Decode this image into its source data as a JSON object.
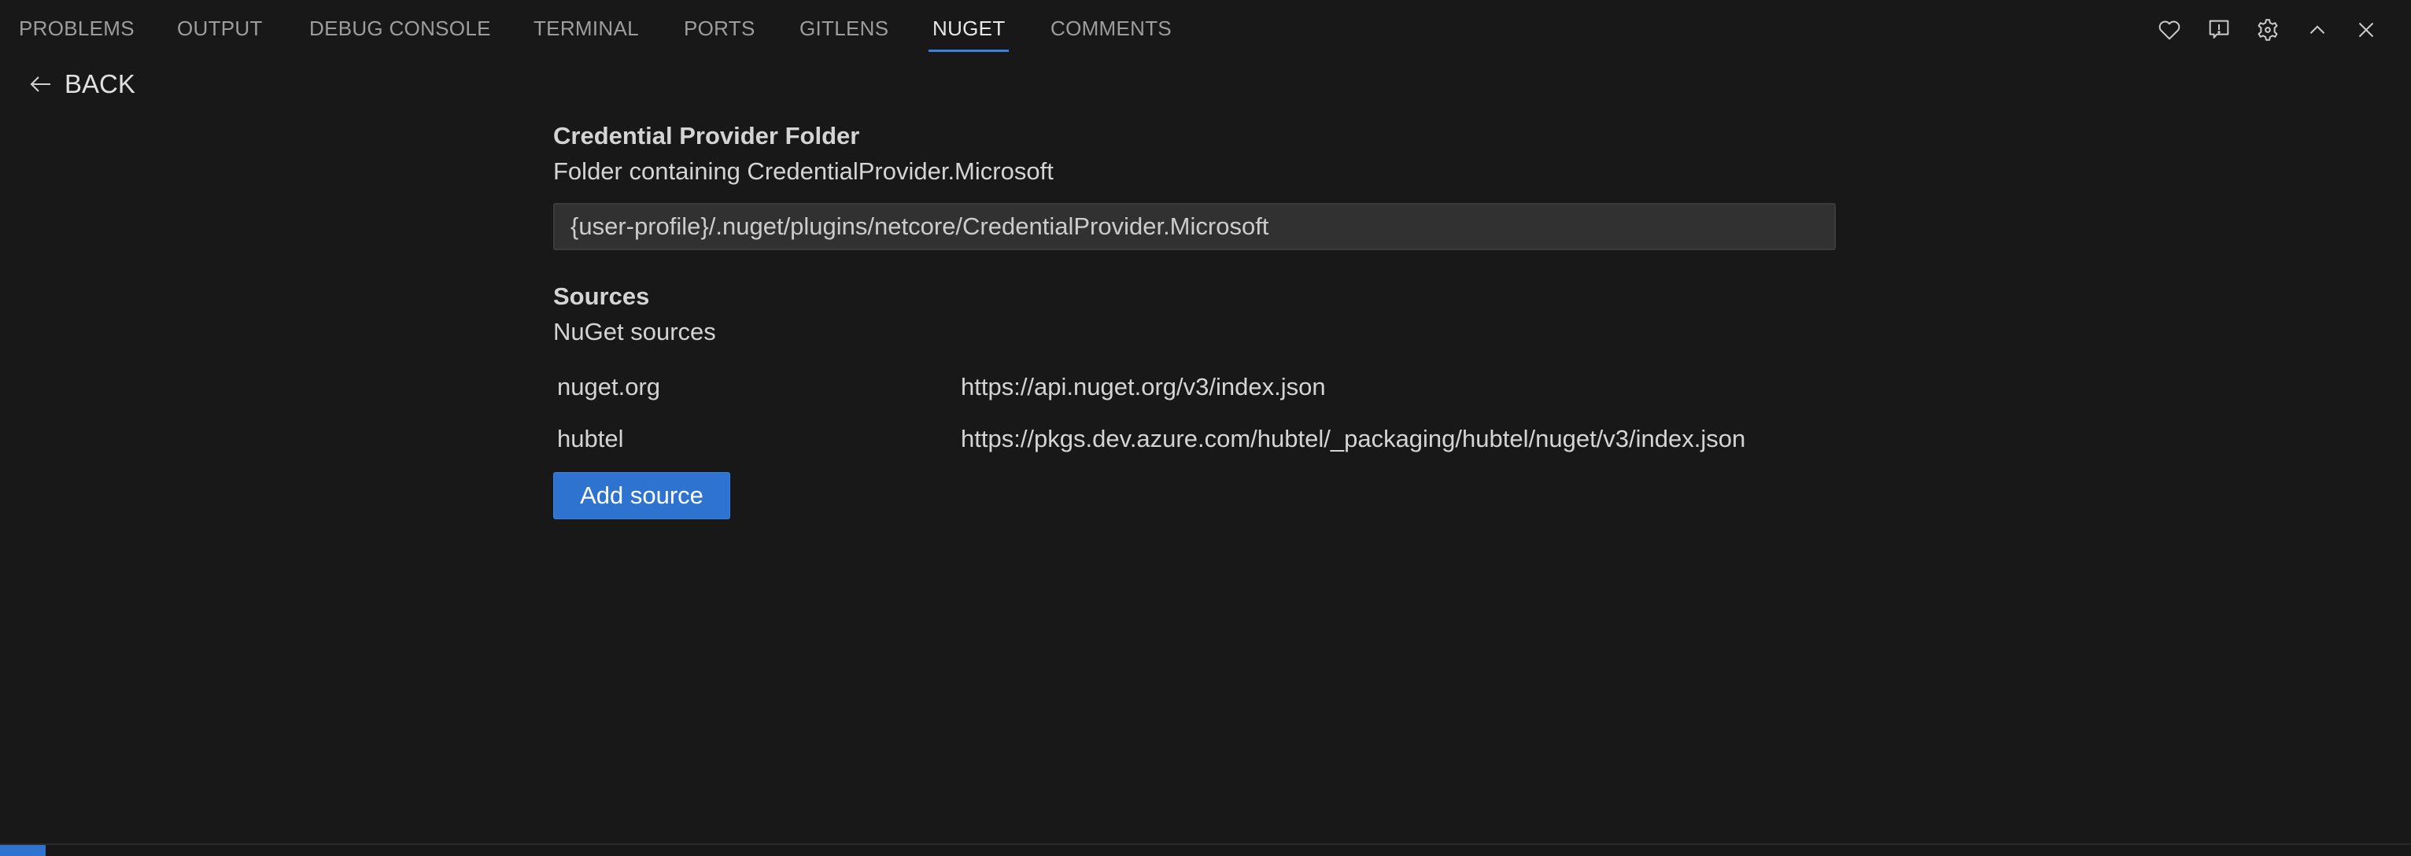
{
  "panel": {
    "tabs": [
      {
        "label": "PROBLEMS",
        "active": false
      },
      {
        "label": "OUTPUT",
        "active": false
      },
      {
        "label": "DEBUG CONSOLE",
        "active": false
      },
      {
        "label": "TERMINAL",
        "active": false
      },
      {
        "label": "PORTS",
        "active": false
      },
      {
        "label": "GITLENS",
        "active": false
      },
      {
        "label": "NUGET",
        "active": true
      },
      {
        "label": "COMMENTS",
        "active": false
      }
    ],
    "actions": [
      {
        "icon": "heart-icon",
        "label": "Sponsor"
      },
      {
        "icon": "feedback-icon",
        "label": "Report Issue"
      },
      {
        "icon": "gear-icon",
        "label": "Settings"
      },
      {
        "icon": "chevron-up-icon",
        "label": "Maximize Panel"
      },
      {
        "icon": "close-icon",
        "label": "Close Panel"
      }
    ],
    "accent_color": "#3b7fd6"
  },
  "back": {
    "label": "BACK",
    "icon": "arrow-left-icon"
  },
  "credential_provider": {
    "title": "Credential Provider Folder",
    "description": "Folder containing CredentialProvider.Microsoft",
    "value": "{user-profile}/.nuget/plugins/netcore/CredentialProvider.Microsoft"
  },
  "sources": {
    "title": "Sources",
    "description": "NuGet sources",
    "items": [
      {
        "name": "nuget.org",
        "url": "https://api.nuget.org/v3/index.json"
      },
      {
        "name": "hubtel",
        "url": "https://pkgs.dev.azure.com/hubtel/_packaging/hubtel/nuget/v3/index.json"
      }
    ],
    "add_button_label": "Add source",
    "button_color": "#2f73d1"
  }
}
